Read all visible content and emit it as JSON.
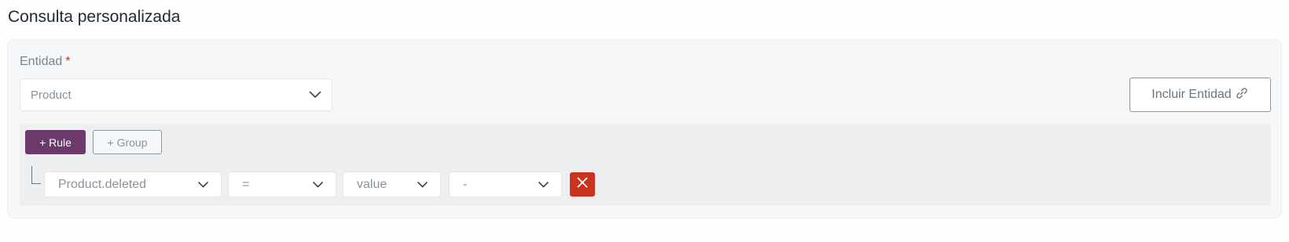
{
  "page": {
    "title": "Consulta personalizada"
  },
  "entity": {
    "label": "Entidad",
    "required_mark": "*",
    "selected": "Product",
    "include_label": "Incluir Entidad"
  },
  "query_builder": {
    "add_rule_label": "+ Rule",
    "add_group_label": "+ Group",
    "rules": [
      {
        "field": "Product.deleted",
        "operator": "=",
        "value_type": "value",
        "value": "-"
      }
    ]
  },
  "colors": {
    "accent": "#6b3a6b",
    "danger": "#c9331f",
    "required": "#c0392b"
  },
  "icons": {
    "dropdown": "chevron-down-icon",
    "include": "link-icon",
    "remove": "close-icon"
  }
}
